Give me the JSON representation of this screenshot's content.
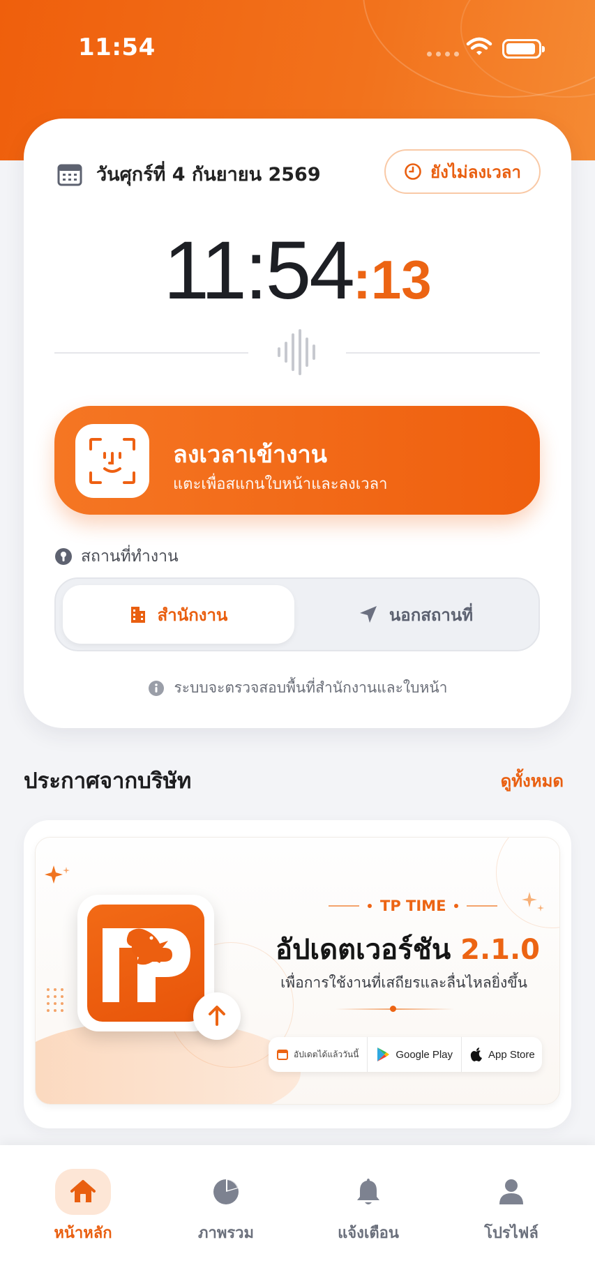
{
  "status_bar": {
    "time": "11:54"
  },
  "header": {
    "date": "วันศุกร์ที่ 4 กันยายน 2569",
    "attendance_status": "ยังไม่ลงเวลา"
  },
  "clock": {
    "hours_minutes": "11:54",
    "seconds": ":13"
  },
  "checkin": {
    "title": "ลงเวลาเข้างาน",
    "subtitle": "แตะเพื่อสแกนใบหน้าและลงเวลา"
  },
  "location": {
    "label": "สถานที่ทำงาน",
    "options": [
      {
        "label": "สำนักงาน",
        "icon": "building-icon",
        "selected": true
      },
      {
        "label": "นอกสถานที่",
        "icon": "navigation-arrow-icon",
        "selected": false
      }
    ],
    "note": "ระบบจะตรวจสอบพื้นที่สำนักงานและใบหน้า"
  },
  "announcements": {
    "title": "ประกาศจากบริษัท",
    "see_all": "ดูทั้งหมด",
    "banner": {
      "brand": "TP TIME",
      "title_prefix": "อัปเดตเวอร์ชัน",
      "version": "2.1.0",
      "subtitle": "เพื่อการใช้งานที่เสถียรและลื่นไหลยิ่งขึ้น",
      "store_note": "อัปเดตได้แล้ววันนี้",
      "store_google": "Google Play",
      "store_apple": "App Store"
    }
  },
  "tabs": [
    {
      "label": "หน้าหลัก",
      "icon": "home-icon",
      "active": true
    },
    {
      "label": "ภาพรวม",
      "icon": "pie-chart-icon",
      "active": false
    },
    {
      "label": "แจ้งเตือน",
      "icon": "bell-icon",
      "active": false
    },
    {
      "label": "โปรไฟล์",
      "icon": "user-icon",
      "active": false
    }
  ],
  "colors": {
    "accent": "#ec6413",
    "accent_dark": "#e8550a",
    "background": "#f3f4f7"
  }
}
